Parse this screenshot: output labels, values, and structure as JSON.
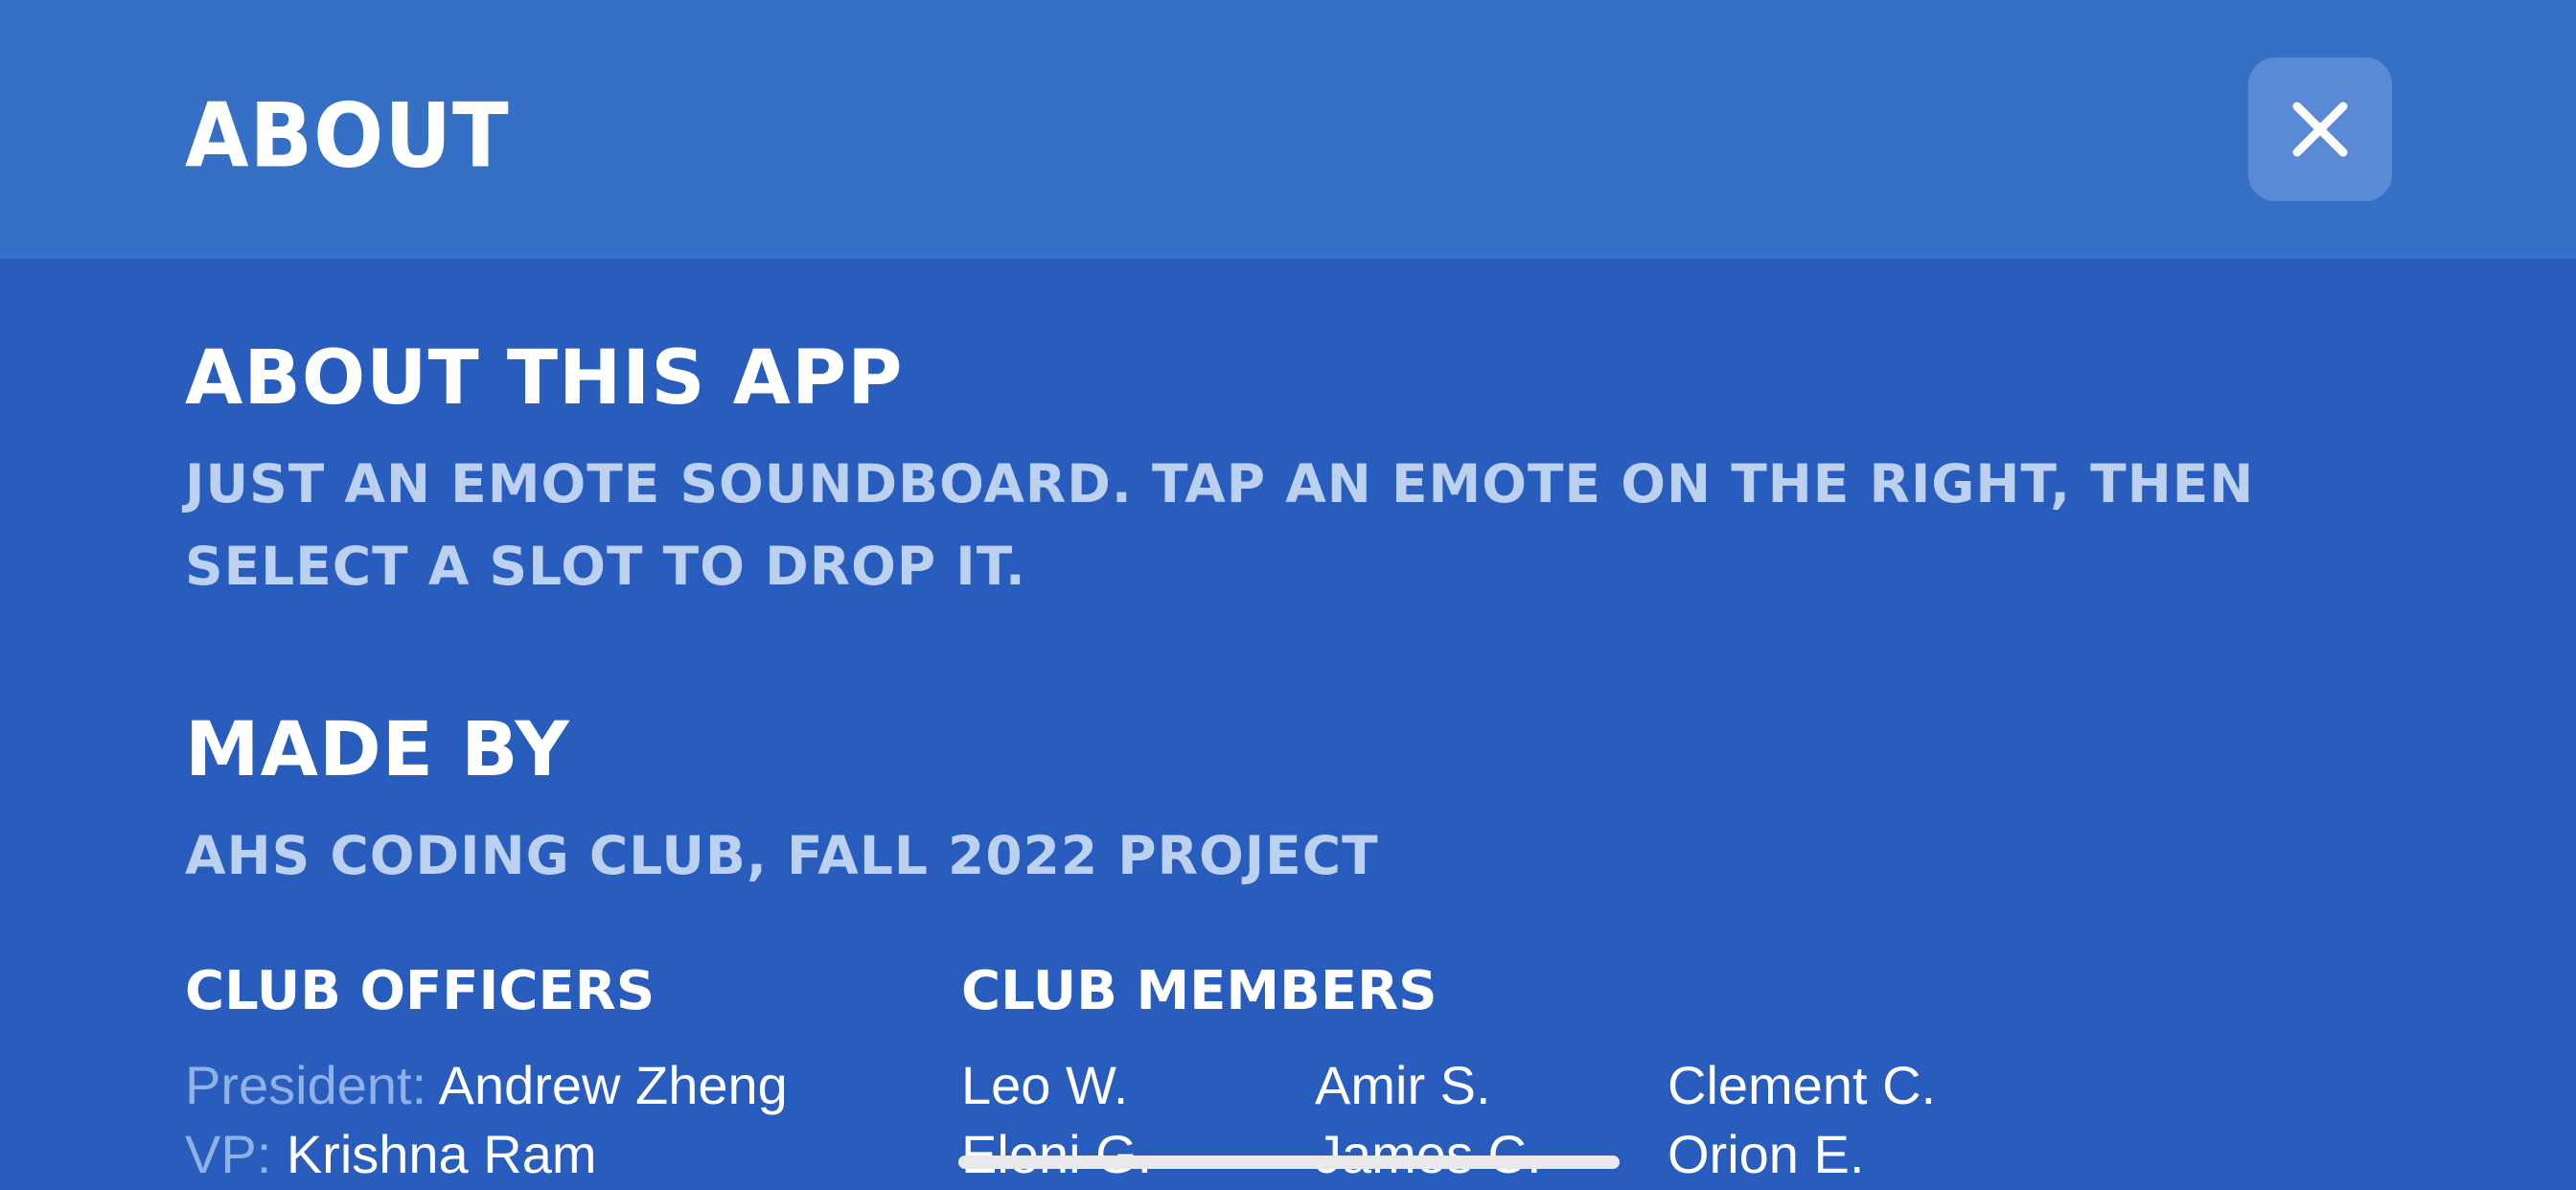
{
  "header": {
    "title": "ABOUT",
    "close_icon": "close-icon"
  },
  "about_app": {
    "heading": "ABOUT THIS APP",
    "description": "JUST AN EMOTE SOUNDBOARD. TAP AN EMOTE ON THE RIGHT, THEN SELECT A SLOT TO DROP IT."
  },
  "made_by": {
    "heading": "MADE BY",
    "description": "AHS CODING CLUB, FALL 2022 PROJECT"
  },
  "officers": {
    "heading": "CLUB OFFICERS",
    "items": [
      {
        "role": "President:",
        "name": "Andrew Zheng"
      },
      {
        "role": "VP:",
        "name": "Krishna Ram"
      }
    ]
  },
  "members": {
    "heading": "CLUB MEMBERS",
    "names": [
      "Leo W.",
      "Amir S.",
      "Clement C.",
      "Eleni G.",
      "James C.",
      "Orion E."
    ]
  },
  "colors": {
    "header_bg": "#3570c6",
    "content_bg": "#285cbd",
    "description_text": "#bcd0ef",
    "role_text": "#8fb1e6"
  }
}
